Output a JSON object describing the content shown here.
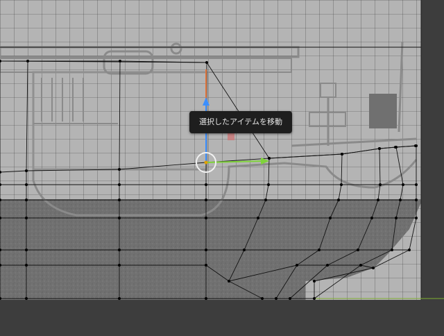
{
  "viewport": {
    "background_color": "#3d3d3d",
    "reference_image": "ship-blueprint-reference",
    "horizon_line_color": "#7fae2f"
  },
  "gizmo": {
    "mode": "translate",
    "x_axis_color": "#7fd33a",
    "y_axis_color": "#3b8fff",
    "z_axis_color": "#e0743a"
  },
  "tooltip": {
    "text": "選択したアイテムを移動"
  },
  "mesh": {
    "wire_color": "#111111",
    "vertex_color": "#000000",
    "rows": 8,
    "columns": 12
  }
}
